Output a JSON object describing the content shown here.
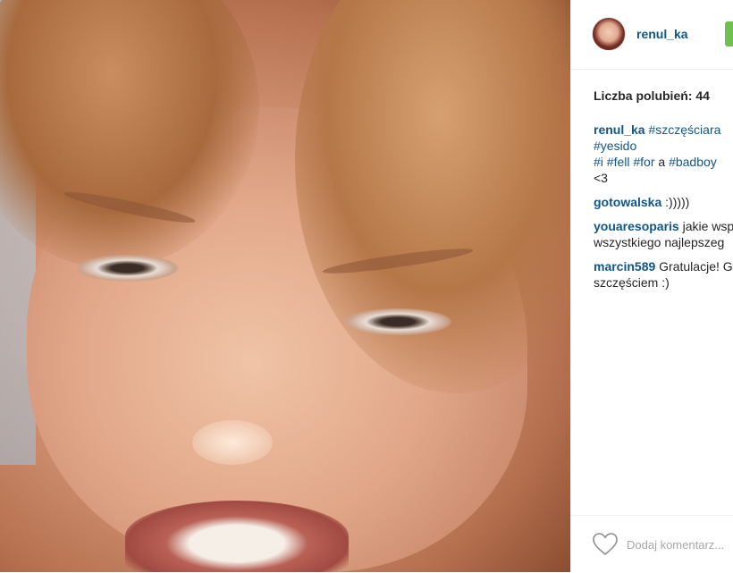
{
  "post": {
    "username": "renul_ka",
    "likes_label": "Liczba polubień: 44",
    "caption": {
      "user": "renul_ka",
      "parts": [
        {
          "t": "tag",
          "v": "#szczęściara"
        },
        {
          "t": "br"
        },
        {
          "t": "tag",
          "v": "#yesido"
        },
        {
          "t": "br"
        },
        {
          "t": "tag",
          "v": "#i"
        },
        {
          "t": "txt",
          "v": " "
        },
        {
          "t": "tag",
          "v": "#fell"
        },
        {
          "t": "txt",
          "v": " "
        },
        {
          "t": "tag",
          "v": "#for"
        },
        {
          "t": "txt",
          "v": " a "
        },
        {
          "t": "tag",
          "v": "#badboy"
        },
        {
          "t": "br"
        },
        {
          "t": "txt",
          "v": "<3"
        }
      ]
    },
    "comments": [
      {
        "user": "gotowalska",
        "text": ":)))))"
      },
      {
        "user": "youaresoparis",
        "text": "jakie wsp",
        "text2": "wszystkiego najlepszeg"
      },
      {
        "user": "marcin589",
        "text": "Gratulacje! G",
        "text2": "szczęściem :)"
      }
    ]
  },
  "footer": {
    "like_icon": "heart-outline-icon",
    "comment_placeholder": "Dodaj komentarz..."
  },
  "colors": {
    "link": "#125688",
    "text": "#262626",
    "follow_green": "#70c050",
    "placeholder": "#a5a7aa"
  }
}
